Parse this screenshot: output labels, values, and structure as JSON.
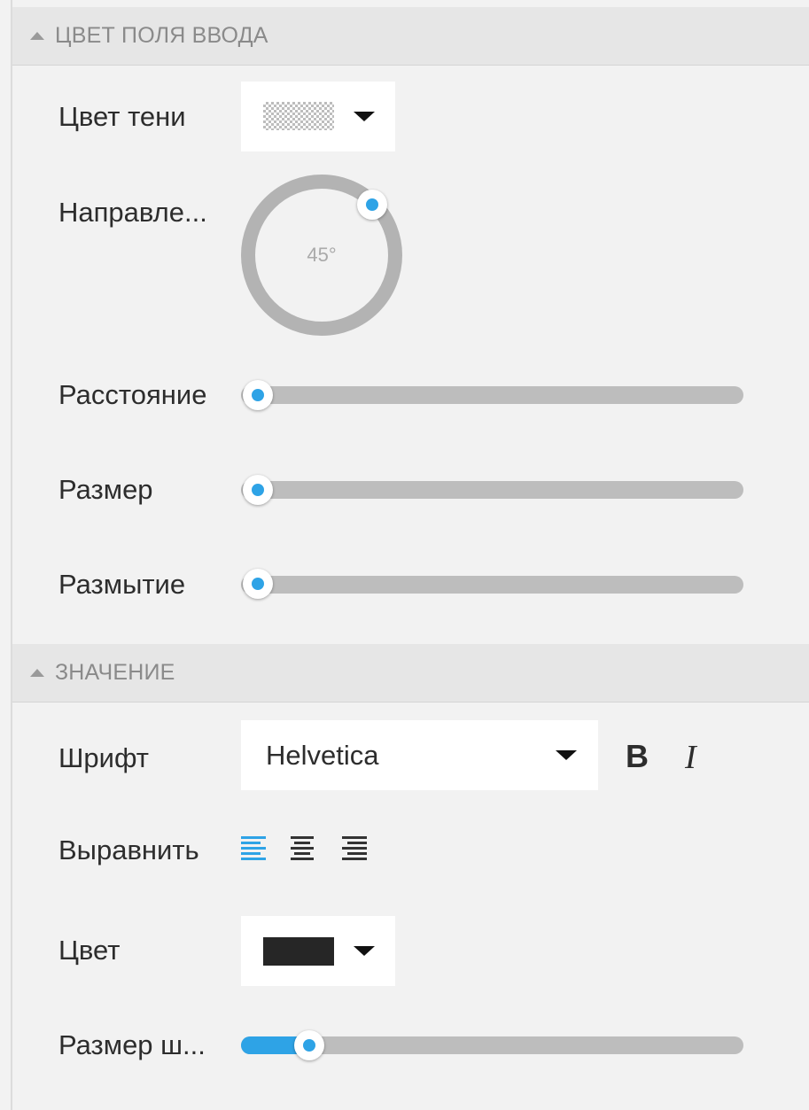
{
  "input_color_section": {
    "header": "ЦВЕТ ПОЛЯ ВВОДА",
    "shadow_color_label": "Цвет тени",
    "direction_label": "Направле...",
    "direction_value": "45°",
    "distance_label": "Расстояние",
    "size_label": "Размер",
    "blur_label": "Размытие",
    "distance_level": 0,
    "size_level": 0,
    "blur_level": 0
  },
  "value_section": {
    "header": "ЗНАЧЕНИЕ",
    "font_label": "Шрифт",
    "font_value": "Helvetica",
    "bold_label": "B",
    "italic_label": "I",
    "align_label": "Выравнить",
    "color_label": "Цвет",
    "color_value": "#262626",
    "font_size_label": "Размер ш...",
    "font_size_level": 0.14
  },
  "colors": {
    "accent": "#2ea3e6",
    "track": "#bdbdbd",
    "background": "#f2f2f2",
    "header_bg": "#e6e6e6"
  },
  "icons": {
    "collapse": "triangle-up-icon",
    "dropdown": "caret-down-icon",
    "align_left": "align-left-icon",
    "align_center": "align-center-icon",
    "align_right": "align-right-icon"
  }
}
